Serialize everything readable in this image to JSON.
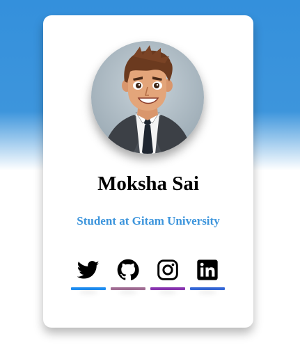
{
  "profile": {
    "name": "Moksha Sai",
    "title": "Student at Gitam University"
  },
  "socials": [
    {
      "icon": "twitter-icon",
      "bar_color": "#1d8cf0"
    },
    {
      "icon": "github-icon",
      "bar_color": "#a06c93"
    },
    {
      "icon": "instagram-icon",
      "bar_color": "#8833b0"
    },
    {
      "icon": "linkedin-icon",
      "bar_color": "#3366d6"
    }
  ],
  "colors": {
    "background_top": "#3490dc",
    "accent": "#3d95dc",
    "card": "#ffffff"
  }
}
